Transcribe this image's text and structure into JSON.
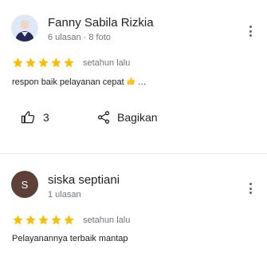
{
  "reviews": [
    {
      "author": "Fanny Sabila Rizkia",
      "meta": "6 ulasan · 8 foto",
      "rating": 5,
      "time": "setahun lalu",
      "text": "respon baik pelayanan cepat",
      "text_suffix": " …",
      "likes": "3",
      "share_label": "Bagikan"
    },
    {
      "author": "siska septiani",
      "avatar_letter": "S",
      "meta": "1 ulasan",
      "rating": 5,
      "time": "setahun lalu",
      "text": "Pelayanannya terbaik mantap"
    }
  ],
  "colors": {
    "star": "#fbbc04",
    "avatar_bg": "#5d4037",
    "text": "#202124",
    "muted": "#70757a"
  },
  "icons": {
    "review_1_avatar": "user-photo",
    "emoji": "thumbs-up-emoji",
    "like": "thumbs-up-icon",
    "share": "share-icon",
    "more": "more-vertical-icon"
  }
}
